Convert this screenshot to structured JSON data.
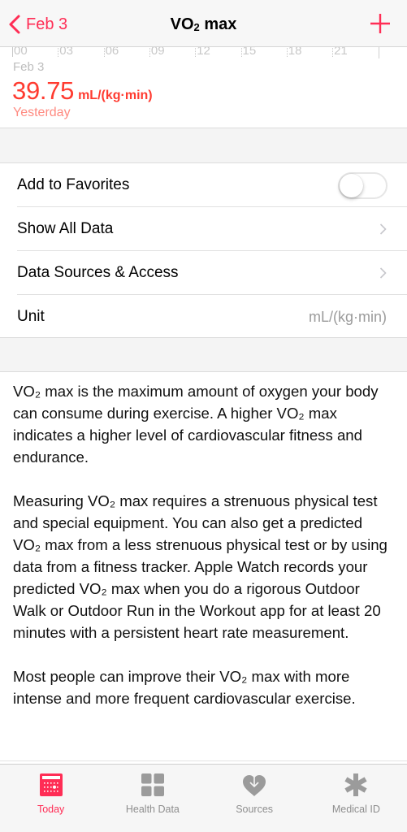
{
  "nav": {
    "back_label": "Feb 3",
    "title_prefix": "VO",
    "title_sub": "2",
    "title_suffix": " max",
    "add_icon": "plus-icon"
  },
  "chart": {
    "axis_ticks": [
      "00",
      "03",
      "06",
      "09",
      "12",
      "15",
      "18",
      "21"
    ],
    "selected_date": "Feb 3",
    "selected_value": "39.75",
    "selected_unit": "mL/(kg·min)",
    "selected_when": "Yesterday"
  },
  "settings": {
    "favorites_label": "Add to Favorites",
    "favorites_on": false,
    "show_all_label": "Show All Data",
    "sources_label": "Data Sources & Access",
    "unit_label": "Unit",
    "unit_value": "mL/(kg·min)"
  },
  "description": {
    "paragraphs": [
      "VO₂ max is the maximum amount of oxygen your body can consume during exercise. A higher VO₂ max indicates a higher level of cardiovascular fitness and endurance.",
      "Measuring VO₂ max requires a strenuous physical test and special equipment. You can also get a predicted VO₂ max from a less strenuous physical test or by using data from a fitness tracker. Apple Watch records your predicted VO₂ max when you do a rigorous Outdoor Walk or Outdoor Run in the Workout app for at least 20 minutes with a persistent heart rate measurement.",
      "Most people can improve their VO₂ max with more intense and more frequent cardiovascular exercise."
    ]
  },
  "tabs": [
    {
      "label": "Today",
      "icon": "calendar-icon",
      "active": true
    },
    {
      "label": "Health Data",
      "icon": "grid-icon",
      "active": false
    },
    {
      "label": "Sources",
      "icon": "heart-download-icon",
      "active": false
    },
    {
      "label": "Medical ID",
      "icon": "asterisk-icon",
      "active": false
    }
  ],
  "colors": {
    "accent": "#ff2d55",
    "value_red": "#ff3b30",
    "secondary_red": "#ff8a80",
    "inactive_gray": "#8e8e8e"
  }
}
